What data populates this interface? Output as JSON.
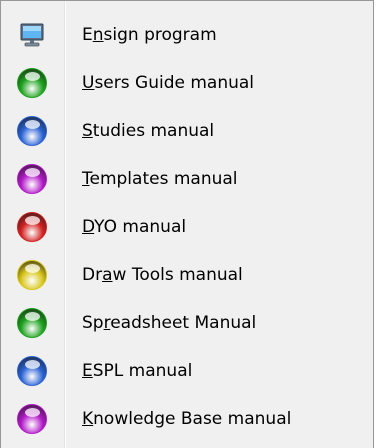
{
  "menu": {
    "items": [
      {
        "id": "ensign-program",
        "pre": "E",
        "accel": "n",
        "post": "sign program",
        "icon": "computer-icon"
      },
      {
        "id": "users-guide-manual",
        "pre": "",
        "accel": "U",
        "post": "sers Guide manual",
        "icon": "green-orb-icon",
        "color": "#1fa21f"
      },
      {
        "id": "studies-manual",
        "pre": "",
        "accel": "S",
        "post": "tudies manual",
        "icon": "blue-orb-icon",
        "color": "#2a62d4"
      },
      {
        "id": "templates-manual",
        "pre": "",
        "accel": "T",
        "post": "emplates manual",
        "icon": "purple-orb-icon",
        "color": "#b319c9"
      },
      {
        "id": "dyo-manual",
        "pre": "",
        "accel": "D",
        "post": "YO manual",
        "icon": "red-orb-icon",
        "color": "#d22222"
      },
      {
        "id": "draw-tools-manual",
        "pre": "Dr",
        "accel": "a",
        "post": "w Tools manual",
        "icon": "yellow-orb-icon",
        "color": "#d8c61a"
      },
      {
        "id": "spreadsheet-manual",
        "pre": "Sp",
        "accel": "r",
        "post": "eadsheet Manual",
        "icon": "green-orb-icon",
        "color": "#1fa21f"
      },
      {
        "id": "espl-manual",
        "pre": "",
        "accel": "E",
        "post": "SPL manual",
        "icon": "blue-orb-icon",
        "color": "#2a62d4"
      },
      {
        "id": "knowledge-base-manual",
        "pre": "",
        "accel": "K",
        "post": "nowledge Base manual",
        "icon": "purple-orb-icon",
        "color": "#b319c9"
      }
    ]
  }
}
